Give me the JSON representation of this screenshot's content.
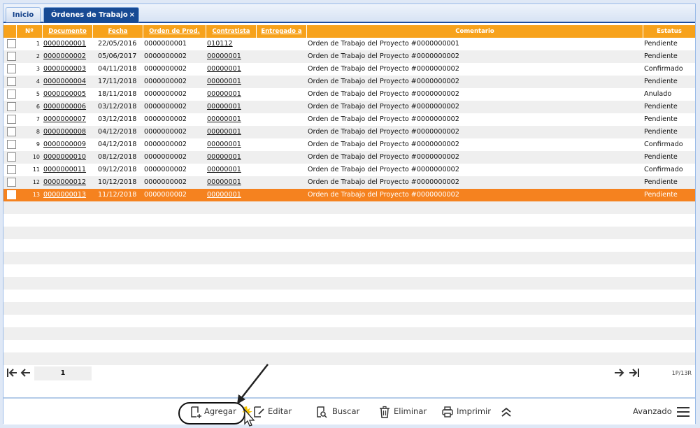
{
  "tabs": [
    {
      "label": "Inicio"
    },
    {
      "label": "Órdenes de Trabajo",
      "close": "×"
    }
  ],
  "table": {
    "columns": [
      "Nº",
      "Documento",
      "Fecha",
      "Orden de Prod.",
      "Contratista",
      "Entregado a",
      "Comentario",
      "Estatus"
    ],
    "rows": [
      {
        "n": "1",
        "doc": "0000000001",
        "fecha": "22/05/2016",
        "orden": "0000000001",
        "contratista": "010112",
        "entregado": "",
        "comentario": "Orden de Trabajo del Proyecto #0000000001",
        "estatus": "Pendiente"
      },
      {
        "n": "2",
        "doc": "0000000002",
        "fecha": "05/06/2017",
        "orden": "0000000002",
        "contratista": "00000001",
        "entregado": "",
        "comentario": "Orden de Trabajo del Proyecto #0000000002",
        "estatus": "Pendiente"
      },
      {
        "n": "3",
        "doc": "0000000003",
        "fecha": "04/11/2018",
        "orden": "0000000002",
        "contratista": "00000001",
        "entregado": "",
        "comentario": "Orden de Trabajo del Proyecto #0000000002",
        "estatus": "Confirmado"
      },
      {
        "n": "4",
        "doc": "0000000004",
        "fecha": "17/11/2018",
        "orden": "0000000002",
        "contratista": "00000001",
        "entregado": "",
        "comentario": "Orden de Trabajo del Proyecto #0000000002",
        "estatus": "Pendiente"
      },
      {
        "n": "5",
        "doc": "0000000005",
        "fecha": "18/11/2018",
        "orden": "0000000002",
        "contratista": "00000001",
        "entregado": "",
        "comentario": "Orden de Trabajo del Proyecto #0000000002",
        "estatus": "Anulado"
      },
      {
        "n": "6",
        "doc": "0000000006",
        "fecha": "03/12/2018",
        "orden": "0000000002",
        "contratista": "00000001",
        "entregado": "",
        "comentario": "Orden de Trabajo del Proyecto #0000000002",
        "estatus": "Pendiente"
      },
      {
        "n": "7",
        "doc": "0000000007",
        "fecha": "03/12/2018",
        "orden": "0000000002",
        "contratista": "00000001",
        "entregado": "",
        "comentario": "Orden de Trabajo del Proyecto #0000000002",
        "estatus": "Pendiente"
      },
      {
        "n": "8",
        "doc": "0000000008",
        "fecha": "04/12/2018",
        "orden": "0000000002",
        "contratista": "00000001",
        "entregado": "",
        "comentario": "Orden de Trabajo del Proyecto #0000000002",
        "estatus": "Pendiente"
      },
      {
        "n": "9",
        "doc": "0000000009",
        "fecha": "04/12/2018",
        "orden": "0000000002",
        "contratista": "00000001",
        "entregado": "",
        "comentario": "Orden de Trabajo del Proyecto #0000000002",
        "estatus": "Confirmado"
      },
      {
        "n": "10",
        "doc": "0000000010",
        "fecha": "08/12/2018",
        "orden": "0000000002",
        "contratista": "00000001",
        "entregado": "",
        "comentario": "Orden de Trabajo del Proyecto #0000000002",
        "estatus": "Pendiente"
      },
      {
        "n": "11",
        "doc": "0000000011",
        "fecha": "09/12/2018",
        "orden": "0000000002",
        "contratista": "00000001",
        "entregado": "",
        "comentario": "Orden de Trabajo del Proyecto #0000000002",
        "estatus": "Confirmado"
      },
      {
        "n": "12",
        "doc": "0000000012",
        "fecha": "10/12/2018",
        "orden": "0000000002",
        "contratista": "00000001",
        "entregado": "",
        "comentario": "Orden de Trabajo del Proyecto #0000000002",
        "estatus": "Pendiente"
      },
      {
        "n": "13",
        "doc": "0000000013",
        "fecha": "11/12/2018",
        "orden": "0000000002",
        "contratista": "00000001",
        "entregado": "",
        "comentario": "Orden de Trabajo del Proyecto #0000000002",
        "estatus": "Pendiente",
        "selected": true
      }
    ]
  },
  "pager": {
    "page": "1",
    "info": "1P/13R"
  },
  "toolbar": {
    "agregar": "Agregar",
    "editar": "Editar",
    "buscar": "Buscar",
    "eliminar": "Eliminar",
    "imprimir": "Imprimir",
    "avanzado": "Avanzado"
  },
  "colors": {
    "header": "#f7a21b",
    "selected_row": "#f5821f",
    "active_tab": "#174a94"
  }
}
